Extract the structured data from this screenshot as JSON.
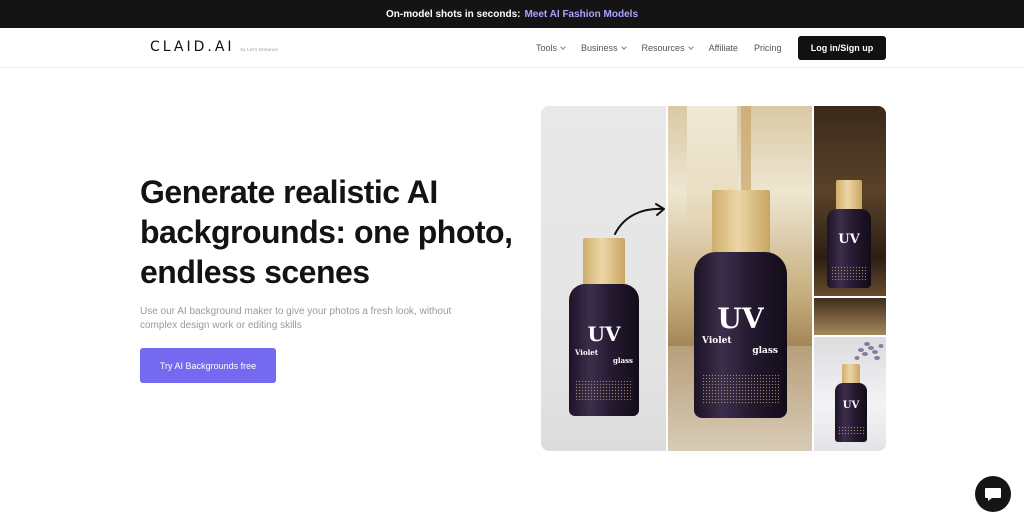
{
  "announcement": {
    "text": "On-model shots in seconds:",
    "link": "Meet AI Fashion Models"
  },
  "brand": {
    "logo": "CLAID.AI",
    "logo_sub": "by Let's Enhance"
  },
  "nav": {
    "items": [
      {
        "label": "Tools",
        "has_dropdown": true
      },
      {
        "label": "Business",
        "has_dropdown": true
      },
      {
        "label": "Resources",
        "has_dropdown": true
      },
      {
        "label": "Affiliate",
        "has_dropdown": false
      },
      {
        "label": "Pricing",
        "has_dropdown": false
      }
    ],
    "login_label": "Log in/Sign up"
  },
  "hero": {
    "title": "Generate realistic AI backgrounds: one photo, endless scenes",
    "subtitle": "Use our AI background maker to give your photos a fresh look, without complex design work or editing skills",
    "cta_label": "Try AI Backgrounds free"
  },
  "product": {
    "brand_mark": "UV",
    "name_line1": "Violet",
    "name_line2": "glass"
  },
  "colors": {
    "announcement_bg": "#141414",
    "announcement_link": "#a9a4ff",
    "cta": "#7569f1",
    "login_bg": "#111111"
  },
  "icons": {
    "chat": "chat-bubble-icon",
    "arrow": "curved-arrow-icon"
  }
}
